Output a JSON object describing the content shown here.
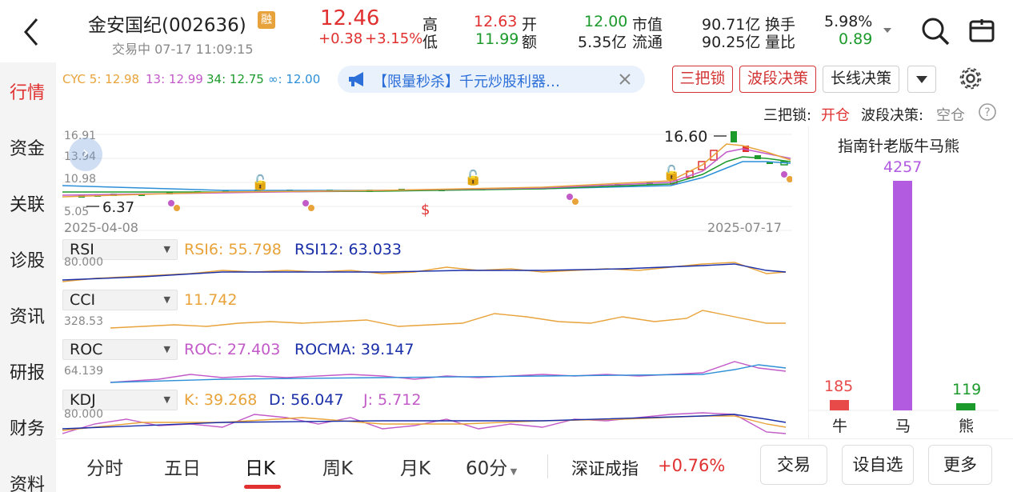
{
  "header": {
    "back_icon": "chevron-left-icon",
    "stock_name": "金安国纪(002636)",
    "margin_badge": "融",
    "status": "交易中 07-17 11:09:15",
    "price": "12.46",
    "change": "+0.38",
    "change_pct": "+3.15%",
    "high_label": "高",
    "high_value": "12.63",
    "low_label": "低",
    "low_value": "11.99",
    "open_label": "开",
    "open_value": "12.00",
    "amount_label": "额",
    "amount_value": "5.35亿",
    "mcap_label": "市值",
    "mcap_value": "90.71亿",
    "float_label": "流通",
    "float_value": "90.25亿",
    "turnover_label": "换手",
    "turnover_value": "5.98%",
    "volratio_label": "量比",
    "volratio_value": "0.89",
    "expand_icon": "triangle-down-icon",
    "search_icon": "search-icon",
    "watchlist_icon": "folder-icon"
  },
  "sidebar": {
    "items": [
      "行情",
      "资金",
      "关联",
      "诊股",
      "资讯",
      "研报",
      "财务",
      "资料"
    ],
    "active": "行情"
  },
  "chart_toolbar": {
    "cyc_label": "CYC 5: 12.98",
    "cyc13": "13: 12.99",
    "cyc34": "34: 12.75",
    "cycinf": "∞: 12.00",
    "ad_text": "【限量秒杀】千元炒股利器…",
    "ad_icon": "megaphone-icon",
    "ad_close_icon": "close-icon",
    "btn_sanbasuo": "三把锁",
    "btn_boduan": "波段决策",
    "btn_changxian": "长线决策",
    "dropdown_icon": "triangle-down-icon",
    "settings_icon": "gear-icon"
  },
  "signal_line": {
    "sanbasuo_label": "三把锁:",
    "sanbasuo_value": "开仓",
    "boduan_label": "波段决策:",
    "boduan_value": "空仓",
    "help_icon": "question-icon"
  },
  "main_chart": {
    "y_top": "16.91",
    "y_2": "13.94",
    "y_3": "10.98",
    "y_low": "5.05",
    "low_marker": "6.37",
    "high_marker": "16.60",
    "date_start": "2025-04-08",
    "date_end": "2025-07-17",
    "colors": {
      "cyc5": "#e8a33a",
      "cyc13": "#c25ac8",
      "cyc34": "#1c9a2c",
      "cycinf": "#2d8fd8",
      "up": "#e03030",
      "down": "#1c9a2c"
    }
  },
  "indicators": {
    "rsi": {
      "name": "RSI",
      "v1": "RSI6: 55.798",
      "v2": "RSI12: 63.033",
      "axis": "80.000"
    },
    "cci": {
      "name": "CCI",
      "v1": "11.742",
      "axis": "328.53"
    },
    "roc": {
      "name": "ROC",
      "v1": "ROC: 27.403",
      "v2": "ROCMA: 39.147",
      "axis": "64.139"
    },
    "kdj": {
      "name": "KDJ",
      "v1": "K: 39.268",
      "v2": "D: 56.047",
      "v3": "J: 5.712",
      "axis": "80.000"
    }
  },
  "bull_bear": {
    "title": "指南针老版牛马熊",
    "bull_label": "牛",
    "bull_value": "185",
    "horse_label": "马",
    "horse_value": "4257",
    "bear_label": "熊",
    "bear_value": "119",
    "chart_data": {
      "type": "bar",
      "categories": [
        "牛",
        "马",
        "熊"
      ],
      "values": [
        185,
        4257,
        119
      ],
      "title": "指南针老版牛马熊",
      "colors": [
        "#e84a4a",
        "#b25ae0",
        "#1c9a2c"
      ]
    }
  },
  "bottom_bar": {
    "tabs": [
      "分时",
      "五日",
      "日K",
      "周K",
      "月K",
      "60分"
    ],
    "active_tab": "日K",
    "index_name": "深证成指",
    "index_change": "+0.76%",
    "trade_btn": "交易",
    "watch_btn": "设自选",
    "more_btn": "更多"
  }
}
